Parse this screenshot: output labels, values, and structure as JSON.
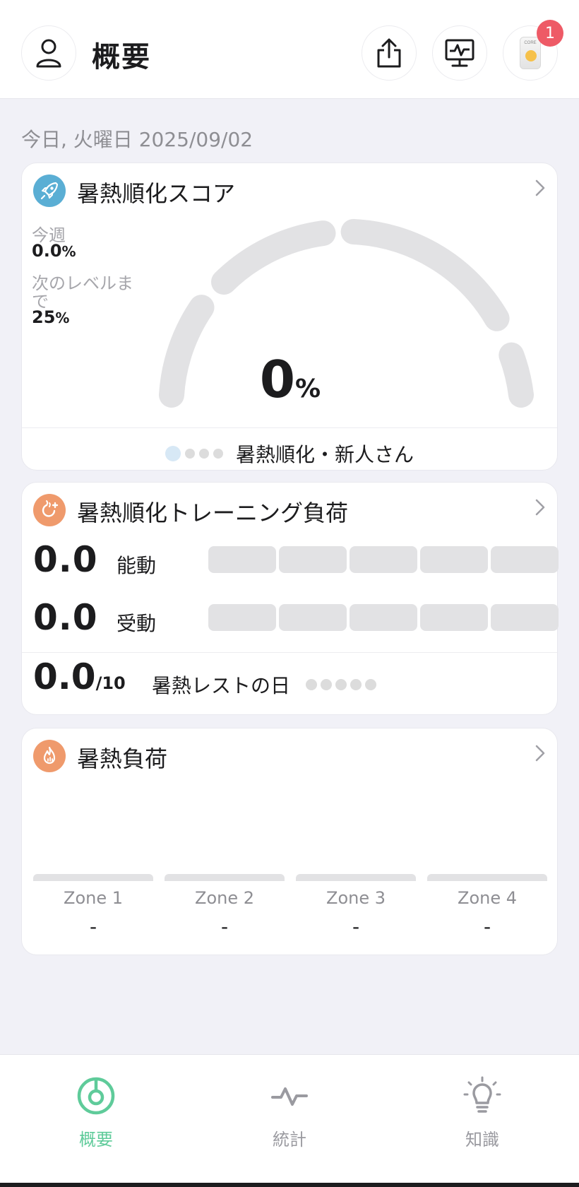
{
  "header": {
    "title": "概要",
    "badge_count": "1",
    "device_label": "CORE"
  },
  "date": "今日, 火曜日 2025/09/02",
  "acclimation_score": {
    "title": "暑熱順化スコア",
    "this_week_label": "今週",
    "this_week_value": "0.0",
    "this_week_unit": "%",
    "next_level_label_line1": "次のレベルま",
    "next_level_label_line2": "で",
    "next_level_value": "25",
    "next_level_unit": "%",
    "score_value": "0",
    "score_unit": "%",
    "level_label": "暑熱順化・新人さん",
    "level_current": 1,
    "level_total": 4
  },
  "training_load": {
    "title": "暑熱順化トレーニング負荷",
    "active_value": "0.0",
    "active_label": "能動",
    "passive_value": "0.0",
    "passive_label": "受動",
    "rest_value": "0.0",
    "rest_max": "/10",
    "rest_label": "暑熱レストの日",
    "rest_dots_filled": 0,
    "rest_dots_total": 5
  },
  "heat_load": {
    "title": "暑熱負荷",
    "zones": [
      {
        "name": "Zone 1",
        "value": "-"
      },
      {
        "name": "Zone 2",
        "value": "-"
      },
      {
        "name": "Zone 3",
        "value": "-"
      },
      {
        "name": "Zone 4",
        "value": "-"
      }
    ]
  },
  "tabs": [
    {
      "label": "概要",
      "active": true
    },
    {
      "label": "統計",
      "active": false
    },
    {
      "label": "知識",
      "active": false
    }
  ],
  "colors": {
    "accent_green": "#5fcb9a",
    "badge_red": "#ee5a66",
    "icon_blue": "#5aaed4",
    "icon_orange": "#ef9a6c",
    "gauge_track": "#e2e2e4"
  }
}
